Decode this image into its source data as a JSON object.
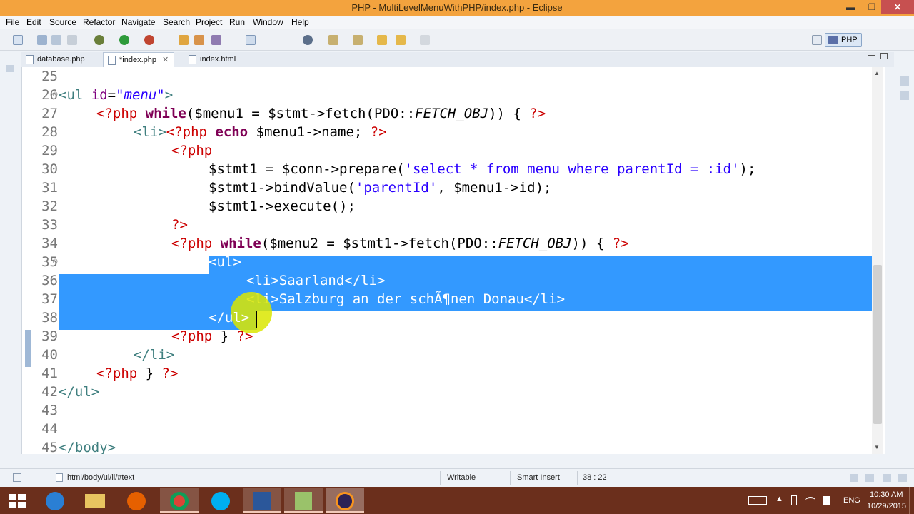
{
  "window": {
    "title": "PHP - MultiLevelMenuWithPHP/index.php - Eclipse",
    "minimize": "▬",
    "maximize": "❐",
    "close": "✕"
  },
  "menu": [
    "File",
    "Edit",
    "Source",
    "Refactor",
    "Navigate",
    "Search",
    "Project",
    "Run",
    "Window",
    "Help"
  ],
  "perspective": {
    "label": "PHP"
  },
  "tabs": [
    {
      "label": "database.php",
      "active": false
    },
    {
      "label": "*index.php",
      "active": true
    },
    {
      "label": "index.html",
      "active": false
    }
  ],
  "tab_close": "✕",
  "editor": {
    "line_numbers": [
      "25",
      "26",
      "27",
      "28",
      "29",
      "30",
      "31",
      "32",
      "33",
      "34",
      "35",
      "36",
      "37",
      "38",
      "39",
      "40",
      "41",
      "42",
      "43",
      "44",
      "45"
    ],
    "code": {
      "l26": {
        "a": "<ul ",
        "b": "id",
        "c": "=",
        "d": "\"menu\"",
        "e": ">"
      },
      "l27": {
        "a": "<?php ",
        "b": "while",
        "c": "($menu1 = $stmt->fetch(PDO::",
        "d": "FETCH_OBJ",
        "e": ")) { ",
        "f": "?>"
      },
      "l28": {
        "a": "<li>",
        "b": "<?php ",
        "c": "echo",
        "d": " $menu1->name; ",
        "e": "?>"
      },
      "l29": {
        "a": "<?php"
      },
      "l30": {
        "a": "$stmt1 = $conn->prepare(",
        "b": "'select * from menu where parentId = :id'",
        "c": ");"
      },
      "l31": {
        "a": "$stmt1->bindValue(",
        "b": "'parentId'",
        "c": ", $menu1->id);"
      },
      "l32": {
        "a": "$stmt1->execute();"
      },
      "l33": {
        "a": "?>"
      },
      "l34": {
        "a": "<?php ",
        "b": "while",
        "c": "($menu2 = $stmt1->fetch(PDO::",
        "d": "FETCH_OBJ",
        "e": ")) { ",
        "f": "?>"
      },
      "l35": {
        "a": "<ul>"
      },
      "l36": {
        "a": "<li>Saarland</li>"
      },
      "l37": {
        "a": "<li>Salzburg an der schÃ¶nen Donau</li>"
      },
      "l38": {
        "a": "</ul>"
      },
      "l39": {
        "a": "<?php ",
        "b": "} ",
        "c": "?>"
      },
      "l40": {
        "a": "</li>"
      },
      "l41": {
        "a": "<?php ",
        "b": "} ",
        "c": "?>"
      },
      "l42": {
        "a": "</ul>"
      },
      "l45": {
        "a": "</body>"
      }
    }
  },
  "status": {
    "breadcrumb": "html/body/ul/li/#text",
    "mode": "Writable",
    "insert": "Smart Insert",
    "position": "38 : 22"
  },
  "tray": {
    "lang": "ENG",
    "time": "10:30 AM",
    "date": "10/29/2015"
  },
  "colors": {
    "title_bar": "#f3a33e",
    "selection": "#3399ff",
    "taskbar": "#6b2f1c",
    "keyword": "#7f0055",
    "php_delim": "#cc0000",
    "string": "#2a00ff",
    "tag": "#3f7f7f"
  }
}
